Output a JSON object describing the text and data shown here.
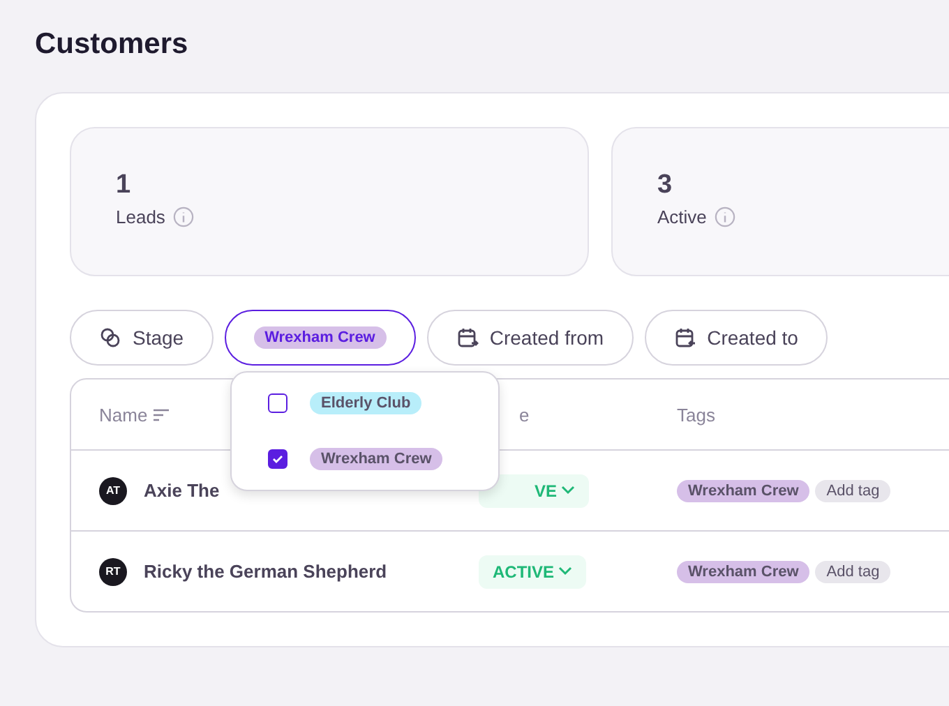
{
  "page_title": "Customers",
  "stats": [
    {
      "value": "1",
      "label": "Leads"
    },
    {
      "value": "3",
      "label": "Active"
    }
  ],
  "filters": [
    {
      "kind": "stage",
      "label": "Stage",
      "selected": false
    },
    {
      "kind": "tag",
      "label": "Wrexham Crew",
      "selected": true
    },
    {
      "kind": "date-from",
      "label": "Created from",
      "selected": false
    },
    {
      "kind": "date-to",
      "label": "Created to",
      "selected": false
    }
  ],
  "tag_menu": [
    {
      "label": "Elderly Club",
      "color": "#b8eefa",
      "checked": false
    },
    {
      "label": "Wrexham Crew",
      "color": "#d6bfe8",
      "checked": true
    }
  ],
  "table": {
    "columns": [
      "Name",
      "e",
      "Tags"
    ],
    "rows": [
      {
        "initials": "AT",
        "name": "Axie The",
        "status": "VE",
        "tags": [
          {
            "label": "Wrexham Crew",
            "kind": "tag"
          },
          {
            "label": "Add tag",
            "kind": "add"
          }
        ]
      },
      {
        "initials": "RT",
        "name": "Ricky the German Shepherd",
        "status": "ACTIVE",
        "tags": [
          {
            "label": "Wrexham Crew",
            "kind": "tag"
          },
          {
            "label": "Add tag",
            "kind": "add"
          }
        ]
      }
    ]
  }
}
